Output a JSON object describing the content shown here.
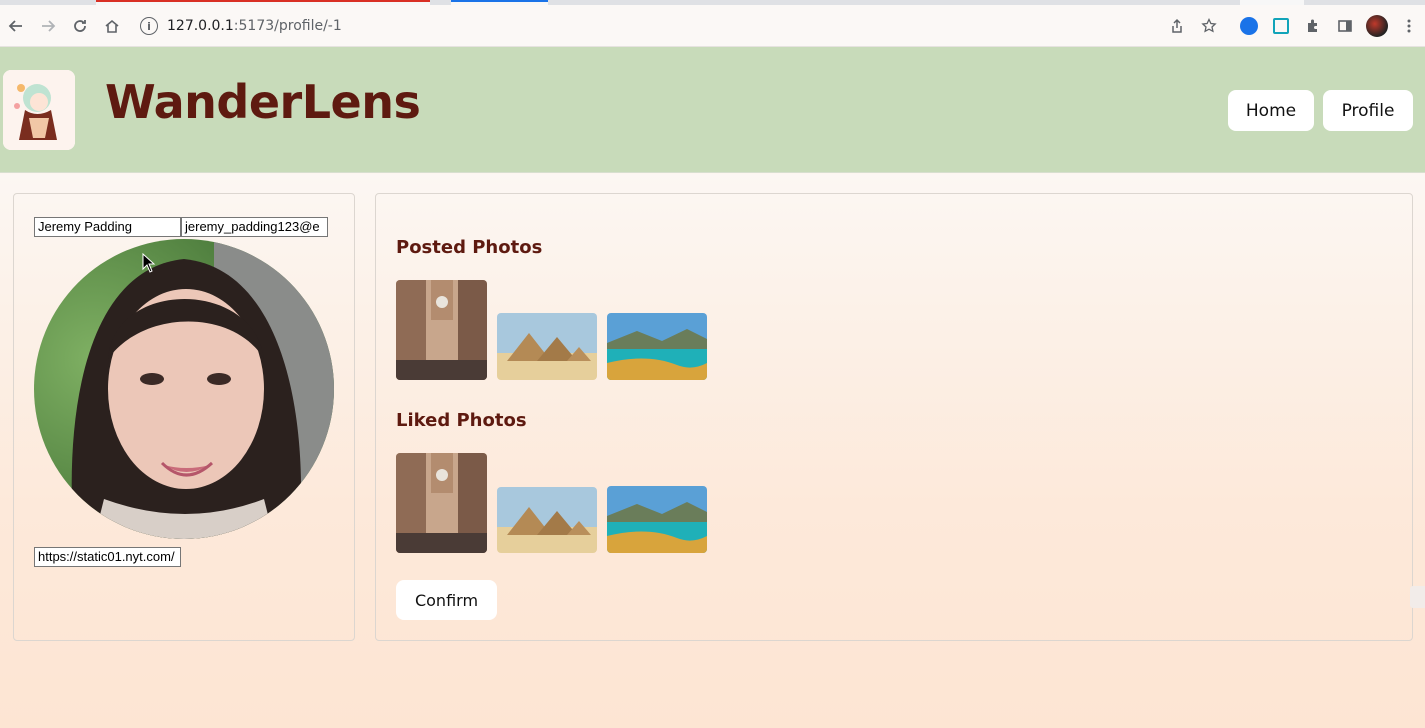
{
  "browser": {
    "url_host": "127.0.0.1",
    "url_path": ":5173/profile/-1",
    "icons": [
      "back-icon",
      "forward-icon",
      "reload-icon",
      "home-icon",
      "share-icon",
      "star-icon",
      "extension-blue-icon",
      "save-extension-icon",
      "puzzle-icon",
      "sidepanel-icon",
      "avatar-icon",
      "menu-icon"
    ]
  },
  "header": {
    "title": "WanderLens",
    "nav": {
      "home": "Home",
      "profile": "Profile"
    }
  },
  "profile": {
    "name_value": "Jeremy Padding",
    "email_value": "jeremy_padding123@e",
    "image_url_value": "https://static01.nyt.com/"
  },
  "sections": {
    "posted_title": "Posted Photos",
    "liked_title": "Liked Photos"
  },
  "photos": [
    {
      "name": "street-photo"
    },
    {
      "name": "pyramids-photo"
    },
    {
      "name": "coast-photo"
    }
  ],
  "confirm_label": "Confirm",
  "colors": {
    "header_bg": "#c8dbba",
    "title": "#5e1a10",
    "page_bg": "#fde9da"
  }
}
